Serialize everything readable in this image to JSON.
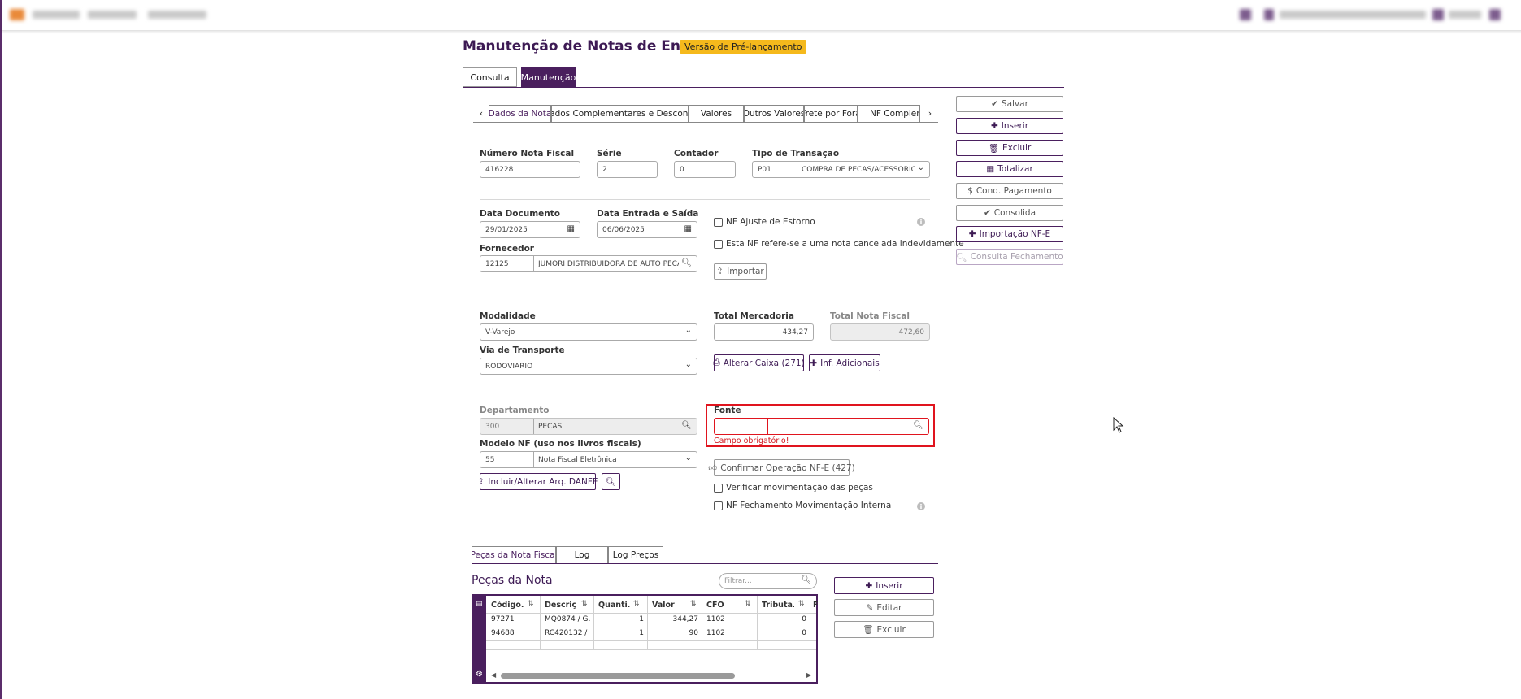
{
  "page": {
    "title": "Manutenção de Notas de Entrada",
    "badge": "Versão de Pré-lançamento"
  },
  "main_tabs": [
    "Consulta",
    "Manutenção"
  ],
  "sub_tabs": [
    "Dados da Nota",
    "Dados Complementares e Desconto",
    "Valores",
    "Outros Valores",
    "Frete por Fora",
    "NF Complemen"
  ],
  "form": {
    "numero_nf": {
      "label": "Número Nota Fiscal",
      "value": "416228"
    },
    "serie": {
      "label": "Série",
      "value": "2"
    },
    "contador": {
      "label": "Contador",
      "value": "0"
    },
    "tipo_transacao": {
      "label": "Tipo de Transação",
      "code": "P01",
      "desc": "COMPRA DE PECAS/ACESSORIOS/LU"
    },
    "data_documento": {
      "label": "Data Documento",
      "value": "29/01/2025"
    },
    "data_entrada": {
      "label": "Data Entrada e Saída",
      "value": "06/06/2025"
    },
    "fornecedor": {
      "label": "Fornecedor",
      "code": "12125",
      "name": "JUMORI DISTRIBUIDORA DE AUTO PECAS LT"
    },
    "nf_ajuste": "NF Ajuste de Estorno",
    "nf_cancelada": "Esta NF refere-se a uma nota cancelada indevidamente",
    "importar": "Importar",
    "modalidade": {
      "label": "Modalidade",
      "value": "V-Varejo"
    },
    "via_transporte": {
      "label": "Via de Transporte",
      "value": "RODOVIARIO"
    },
    "total_mercadoria": {
      "label": "Total Mercadoria",
      "value": "434,27"
    },
    "total_nota": {
      "label": "Total Nota Fiscal",
      "value": "472,60"
    },
    "alterar_caixa": "Alterar Caixa (271)",
    "inf_adicionais": "Inf. Adicionais",
    "departamento": {
      "label": "Departamento",
      "code": "300",
      "name": "PECAS"
    },
    "fonte": {
      "label": "Fonte",
      "code": "",
      "name": "",
      "error": "Campo obrigatório!"
    },
    "modelo_nf": {
      "label": "Modelo NF (uso nos livros fiscais)",
      "code": "55",
      "name": "Nota Fiscal Eletrônica"
    },
    "incluir_danfe": "Incluir/Alterar Arq. DANFE",
    "confirmar_operacao": "Confirmar Operação NF-E (427)",
    "verificar_mov": "Verificar movimentação das peças",
    "nf_fechamento": "NF Fechamento Movimentação Interna"
  },
  "actions": [
    "Salvar",
    "Inserir",
    "Excluir",
    "Totalizar",
    "Cond. Pagamento",
    "Consolida",
    "Importação NF-E",
    "Consulta Fechamento"
  ],
  "bottom_tabs": [
    "Peças da Nota Fiscal",
    "Log",
    "Log Preços"
  ],
  "pecas": {
    "title": "Peças da Nota",
    "filter_placeholder": "Filtrar...",
    "columns": [
      "Código...",
      "Descriç...",
      "Quanti...",
      "Valor",
      "CFO",
      "Tributa..."
    ],
    "rows": [
      [
        "97271",
        "MQ0874 / G...",
        "1",
        "344,27",
        "1102",
        "0"
      ],
      [
        "94688",
        "RC420132 / ...",
        "1",
        "90",
        "1102",
        "0"
      ]
    ],
    "buttons": [
      "Inserir",
      "Editar",
      "Excluir"
    ]
  }
}
